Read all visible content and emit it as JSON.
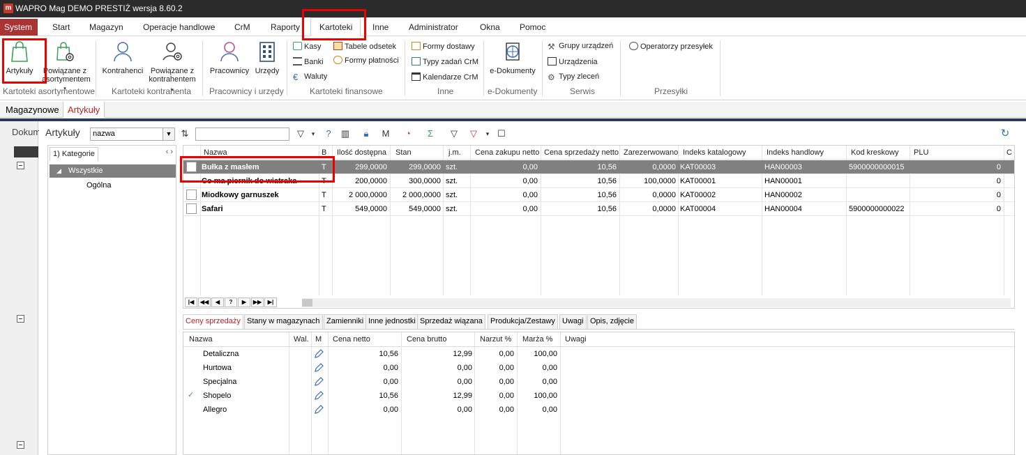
{
  "window": {
    "icon_letter": "m",
    "title": "WAPRO Mag DEMO PRESTIŻ  wersja 8.60.2"
  },
  "menu": {
    "system": "System",
    "items": [
      "Start",
      "Magazyn",
      "Operacje handlowe",
      "CrM",
      "Raporty",
      "Kartoteki",
      "Inne",
      "Administrator",
      "Okna",
      "Pomoc"
    ],
    "active": "Kartoteki"
  },
  "ribbon": {
    "artykuly": "Artykuły",
    "powiazane_asort_1": "Powiązane z",
    "powiazane_asort_2": "asortymentem",
    "kontrahenci": "Kontrahenci",
    "powiazane_kontr_1": "Powiązane z",
    "powiazane_kontr_2": "kontrahentem",
    "pracownicy": "Pracownicy",
    "urzedy": "Urzędy",
    "kasy": "Kasy",
    "banki": "Banki",
    "waluty": "Waluty",
    "tabele_odsetek": "Tabele odsetek",
    "formy_platnosci": "Formy płatności",
    "formy_dostawy": "Formy dostawy",
    "typy_zadan": "Typy zadań CrM",
    "kalendarze": "Kalendarze CrM",
    "e_dokumenty": "e-Dokumenty",
    "grupy_urzadzen": "Grupy urządzeń",
    "urzadzenia": "Urządzenia",
    "typy_zlecen": "Typy zleceń",
    "operatorzy": "Operatorzy przesyłek",
    "groups": {
      "asort": "Kartoteki asortymentowe",
      "kontr": "Kartoteki kontrahenta",
      "prac": "Pracownicy i urzędy",
      "fin": "Kartoteki finansowe",
      "inne": "Inne",
      "edok": "e-Dokumenty",
      "serwis": "Serwis",
      "przesylki": "Przesyłki"
    }
  },
  "subtabs": {
    "magazynowe": "Magazynowe",
    "artykuly": "Artykuły"
  },
  "left": {
    "dokumenty": "Dokum"
  },
  "toolbar": {
    "label": "Artykuły",
    "combo": "nazwa"
  },
  "categories": {
    "tab": "1) Kategorie",
    "all": "Wszystkie",
    "general": "Ogólna"
  },
  "grid": {
    "columns": [
      "Nazwa",
      "B",
      "Ilość dostępna",
      "Stan",
      "j.m.",
      "Cena zakupu netto",
      "Cena sprzedaży netto",
      "Zarezerwowano",
      "Indeks katalogowy",
      "Indeks handlowy",
      "Kod kreskowy",
      "PLU",
      "C"
    ],
    "rows": [
      {
        "nazwa": "Bułka z masłem",
        "b": "T",
        "ilosc": "299,0000",
        "stan": "299,0000",
        "jm": "szt.",
        "zakup": "0,00",
        "sprzedaz": "10,56",
        "rezerw": "0,0000",
        "katalog": "KAT00003",
        "handlowy": "HAN00003",
        "kod": "5900000000015",
        "plu": "0"
      },
      {
        "nazwa": "Co ma piernik do wiatraka",
        "b": "T",
        "ilosc": "200,0000",
        "stan": "300,0000",
        "jm": "szt.",
        "zakup": "0,00",
        "sprzedaz": "10,56",
        "rezerw": "100,0000",
        "katalog": "KAT00001",
        "handlowy": "HAN00001",
        "kod": "",
        "plu": "0"
      },
      {
        "nazwa": "Miodkowy garnuszek",
        "b": "T",
        "ilosc": "2 000,0000",
        "stan": "2 000,0000",
        "jm": "szt.",
        "zakup": "0,00",
        "sprzedaz": "10,56",
        "rezerw": "0,0000",
        "katalog": "KAT00002",
        "handlowy": "HAN00002",
        "kod": "",
        "plu": "0"
      },
      {
        "nazwa": "Safari",
        "b": "T",
        "ilosc": "549,0000",
        "stan": "549,0000",
        "jm": "szt.",
        "zakup": "0,00",
        "sprzedaz": "10,56",
        "rezerw": "0,0000",
        "katalog": "KAT00004",
        "handlowy": "HAN00004",
        "kod": "5900000000022",
        "plu": "0"
      }
    ],
    "selected_row": 0
  },
  "bottom_tabs": [
    "Ceny sprzedaży",
    "Stany w magazynach",
    "Zamienniki",
    "Inne jednostki",
    "Sprzedaż wiązana",
    "Produkcja/Zestawy",
    "Uwagi",
    "Opis, zdjęcie"
  ],
  "prices": {
    "columns": [
      "Nazwa",
      "Wal.",
      "M",
      "Cena netto",
      "Cena brutto",
      "Narzut %",
      "Marża %",
      "Uwagi"
    ],
    "rows": [
      {
        "nazwa": "Detaliczna",
        "netto": "10,56",
        "brutto": "12,99",
        "narzut": "0,00",
        "marza": "100,00",
        "checked": false
      },
      {
        "nazwa": "Hurtowa",
        "netto": "0,00",
        "brutto": "0,00",
        "narzut": "0,00",
        "marza": "0,00",
        "checked": false
      },
      {
        "nazwa": "Specjalna",
        "netto": "0,00",
        "brutto": "0,00",
        "narzut": "0,00",
        "marza": "0,00",
        "checked": false
      },
      {
        "nazwa": "Shopelo",
        "netto": "10,56",
        "brutto": "12,99",
        "narzut": "0,00",
        "marza": "100,00",
        "checked": true
      },
      {
        "nazwa": "Allegro",
        "netto": "0,00",
        "brutto": "0,00",
        "narzut": "0,00",
        "marza": "0,00",
        "checked": false
      }
    ]
  },
  "colors": {
    "titlebar": "#2b2b2b",
    "system": "#aa3333",
    "highlight": "#e00000",
    "selected_row": "#808080",
    "active_tab_text": "#b22222"
  }
}
